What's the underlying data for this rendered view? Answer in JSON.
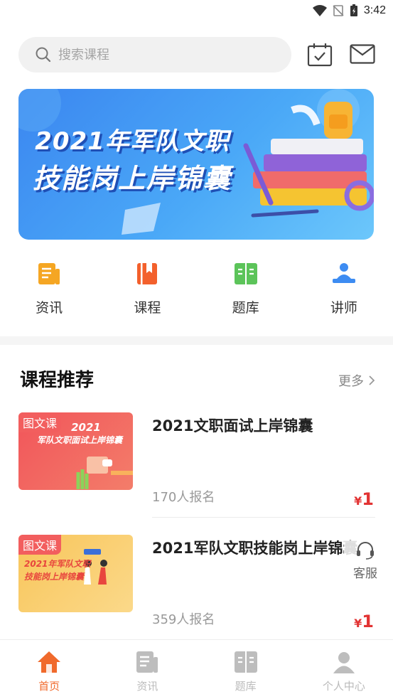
{
  "status_bar": {
    "time": "3:42"
  },
  "search": {
    "placeholder": "搜索课程"
  },
  "banner": {
    "line1": "2021年军队文职",
    "line2": "技能岗上岸锦囊"
  },
  "quick_nav": [
    {
      "label": "资讯",
      "icon": "news-icon",
      "color": "#f5a623"
    },
    {
      "label": "课程",
      "icon": "course-book-icon",
      "color": "#f3602c"
    },
    {
      "label": "题库",
      "icon": "question-bank-icon",
      "color": "#5cc45a"
    },
    {
      "label": "讲师",
      "icon": "lecturer-icon",
      "color": "#3d8cf2"
    }
  ],
  "section": {
    "title": "课程推荐",
    "more": "更多"
  },
  "courses": [
    {
      "tag": "图文课",
      "thumb_line1": "2021",
      "thumb_line2": "军队文职面试上岸锦囊",
      "title": "2021文职面试上岸锦囊",
      "enroll": "170人报名",
      "price_symbol": "¥",
      "price": "1"
    },
    {
      "tag": "图文课",
      "thumb_line1": "2021年军队文职",
      "thumb_line2": "技能岗上岸锦囊",
      "title": "2021军队文职技能岗上岸锦囊",
      "enroll": "359人报名",
      "price_symbol": "¥",
      "price": "1"
    }
  ],
  "service": {
    "label": "客服"
  },
  "tabs": [
    {
      "label": "首页",
      "icon": "home-icon",
      "active": true
    },
    {
      "label": "资讯",
      "icon": "news-tab-icon",
      "active": false
    },
    {
      "label": "题库",
      "icon": "question-bank-tab-icon",
      "active": false
    },
    {
      "label": "个人中心",
      "icon": "profile-icon",
      "active": false
    }
  ],
  "colors": {
    "accent": "#f06a2c",
    "price": "#e23333",
    "banner": "#3b86f0"
  }
}
